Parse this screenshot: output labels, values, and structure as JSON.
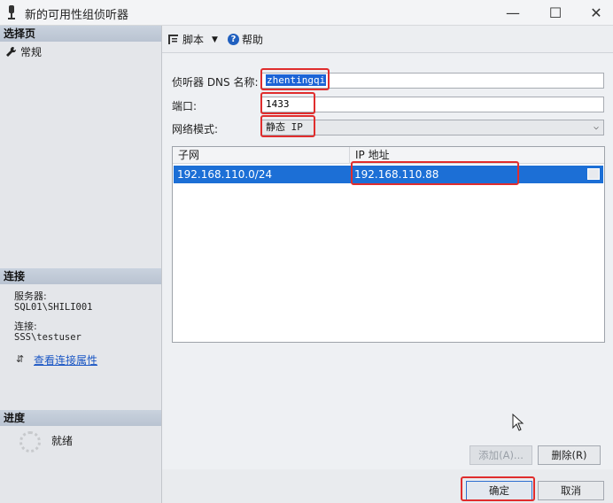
{
  "window": {
    "title": "新的可用性组侦听器",
    "minimize": "—",
    "maximize": "☐",
    "close": "✕"
  },
  "sidebar": {
    "select_page": "选择页",
    "pages": [
      {
        "label": "常规",
        "icon": "wrench-icon"
      }
    ],
    "connection": {
      "header": "连接",
      "server_label": "服务器:",
      "server_value": "SQL01\\SHILI001",
      "conn_label": "连接:",
      "conn_value": "SSS\\testuser",
      "view_link": "查看连接属性"
    },
    "progress": {
      "header": "进度",
      "status": "就绪"
    }
  },
  "toolbar": {
    "script": "脚本",
    "help": "帮助"
  },
  "form": {
    "dns_label": "侦听器 DNS 名称:",
    "dns_value": "zhentingqi",
    "port_label": "端口:",
    "port_value": "1433",
    "network_label": "网络模式:",
    "network_value": "静态 IP"
  },
  "grid": {
    "columns": [
      "子网",
      "IP 地址"
    ],
    "rows": [
      {
        "subnet": "192.168.110.0/24",
        "ip": "192.168.110.88"
      }
    ]
  },
  "buttons": {
    "add": "添加(A)...",
    "remove": "删除(R)",
    "ok": "确定",
    "cancel": "取消"
  },
  "colors": {
    "accent": "#1c6fd6",
    "highlight": "#e02d2d",
    "link": "#1a56c4"
  }
}
